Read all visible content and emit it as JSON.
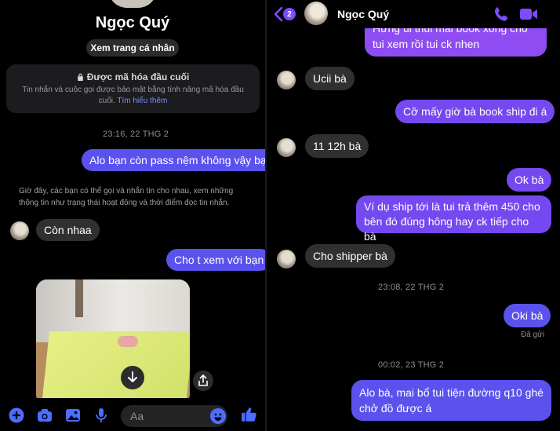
{
  "left": {
    "contact_name": "Ngọc Quý",
    "profile_button": "Xem trang cá nhân",
    "encryption": {
      "title": "Được mã hóa đầu cuối",
      "body": "Tin nhắn và cuộc gọi được bảo mật bằng tính năng mã hóa đầu cuối.",
      "link": "Tìm hiểu thêm"
    },
    "timestamp_1": "23:16, 22 THG 2",
    "msg_1": "Alo bạn còn pass nệm không vậy bạn",
    "notice": "Giờ đây, các bạn có thể gọi và nhắn tin cho nhau, xem những thông tin như trạng thái hoạt động và thời điểm đọc tin nhắn.",
    "msg_2": "Còn nhaa",
    "msg_3": "Cho t xem với bạn",
    "composer": {
      "placeholder": "Aa"
    }
  },
  "right": {
    "header": {
      "back_count": "2",
      "name": "Ngọc Quý"
    },
    "messages": [
      "Hưng ui thui mai book xong cho tui xem rồi tui ck nhen",
      "Ucii bà",
      "Cỡ mấy giờ bà book ship đi á",
      "11 12h bà",
      "Ok bà",
      "Ví dụ ship tới là tui trả thêm 450 cho bên đó đúng hông hay ck tiếp cho bà",
      "Cho shipper bà",
      "Oki bà",
      "Alo bà, mai bổ tui tiện đường q10 ghé chở đồ được á"
    ],
    "timestamp_2": "23:08, 22 THG 2",
    "seen": "Đã gửi",
    "timestamp_3": "00:02, 23 THG 2"
  },
  "colors": {
    "accent_blue": "#5b52ee",
    "accent_purple": "#8f4cf2",
    "icon_blue": "#4e6cff",
    "bubble_in": "#303033"
  },
  "icons": [
    "chevron-left-icon",
    "phone-icon",
    "video-icon",
    "lock-icon",
    "plus-icon",
    "camera-icon",
    "image-icon",
    "microphone-icon",
    "emoji-icon",
    "like-icon",
    "download-icon",
    "share-icon"
  ]
}
